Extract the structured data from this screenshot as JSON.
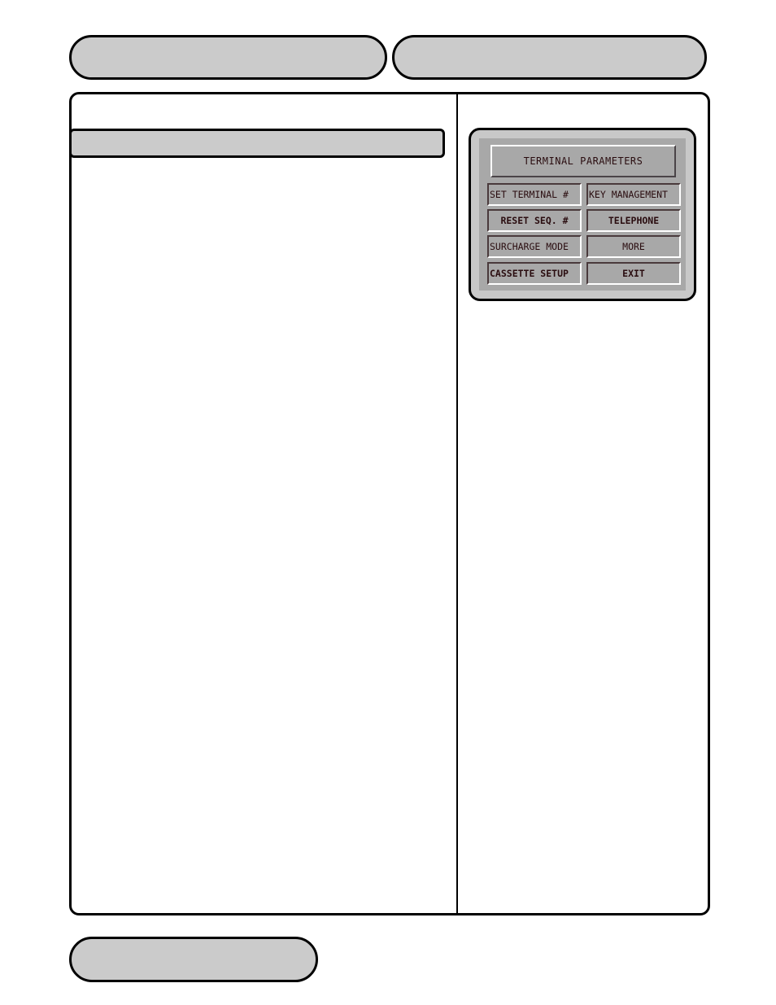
{
  "header": {
    "left_pill_text": "",
    "right_pill_text": ""
  },
  "main": {
    "section_bar_text": "",
    "body_text": ""
  },
  "footer": {
    "pill_text": ""
  },
  "atm_screen": {
    "title": "TERMINAL PARAMETERS",
    "buttons": [
      {
        "label": "SET TERMINAL #",
        "position": "left-1"
      },
      {
        "label": "KEY MANAGEMENT",
        "position": "right-1"
      },
      {
        "label": "RESET SEQ. #",
        "position": "left-2"
      },
      {
        "label": "TELEPHONE",
        "position": "right-2"
      },
      {
        "label": "SURCHARGE MODE",
        "position": "left-3"
      },
      {
        "label": "MORE",
        "position": "right-3"
      },
      {
        "label": "CASSETTE SETUP",
        "position": "left-4"
      },
      {
        "label": "EXIT",
        "position": "right-4"
      }
    ],
    "colors": {
      "panel_outer": "#c8c8c8",
      "panel_inner": "#a8a8a8",
      "text": "#2a0d10"
    }
  },
  "colors": {
    "pill_fill": "#cbcbcb",
    "border": "#000000"
  }
}
